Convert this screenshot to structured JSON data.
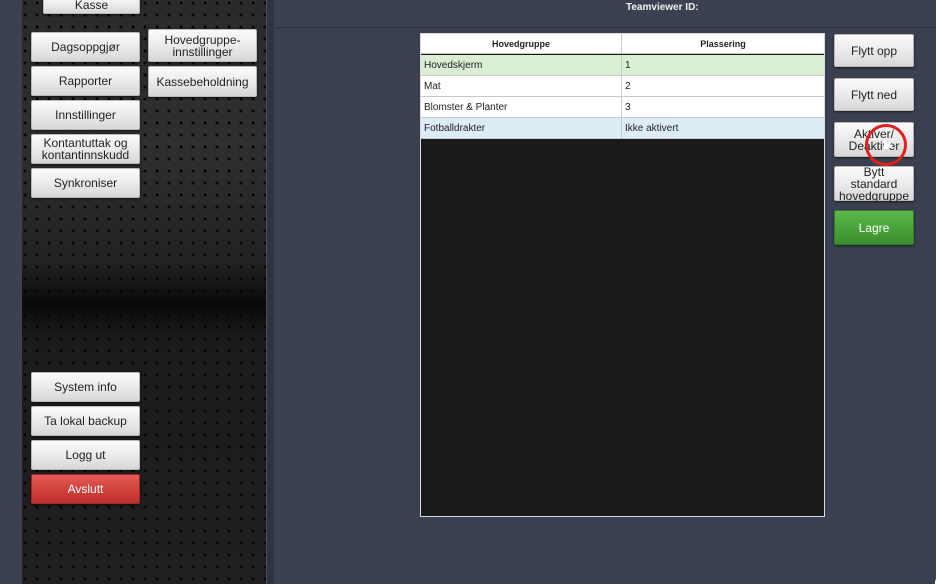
{
  "header": {
    "teamviewer_label": "Teamviewer ID:"
  },
  "sidebar": {
    "top_button": "Kasse",
    "left_column": [
      "Dagsoppgjør",
      "Rapporter",
      "Innstillinger",
      "Kontantuttak og kontantinnskudd",
      "Synkroniser"
    ],
    "right_column": [
      "Hovedgruppe-innstillinger",
      "Kassebeholdning"
    ],
    "bottom_buttons": [
      "System info",
      "Ta lokal backup",
      "Logg ut",
      "Avslutt"
    ]
  },
  "table": {
    "columns": [
      "Hovedgruppe",
      "Plassering"
    ],
    "rows": [
      {
        "name": "Hovedskjerm",
        "position": "1",
        "bg": "#d9eed5"
      },
      {
        "name": "Mat",
        "position": "2",
        "bg": "#ffffff"
      },
      {
        "name": "Blomster & Planter",
        "position": "3",
        "bg": "#ffffff"
      },
      {
        "name": "Fotballdrakter",
        "position": "Ikke aktivert",
        "bg": "#dcedf5"
      }
    ]
  },
  "actions": {
    "move_up": "Flytt opp",
    "move_down": "Flytt ned",
    "toggle": "Aktiver/ Deaktiver",
    "switch_default": "Bytt standard hovedgruppe",
    "save": "Lagre"
  },
  "colors": {
    "background": "#3b4150",
    "selected_row": "#d9eed5",
    "inactive_row": "#dcedf5",
    "save_button": "#47a037",
    "exit_button": "#cf3f3a",
    "cursor_ring": "#e0201c"
  }
}
